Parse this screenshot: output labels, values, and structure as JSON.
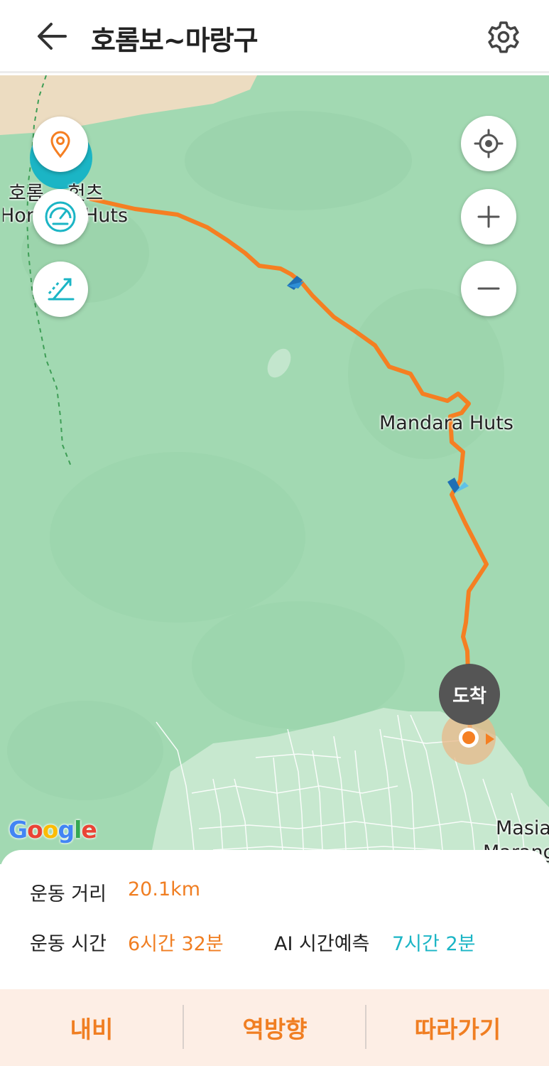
{
  "header": {
    "title": "호롬보~마랑구",
    "back_icon": "arrow-left-icon",
    "settings_icon": "gear-icon"
  },
  "map": {
    "labels": {
      "horombo_ko": "호롬",
      "horombo_ko_2": "헛츠",
      "horombo_en_1": "Horo",
      "horombo_en_2": "Huts",
      "mandara": "Mandara Huts",
      "masia": "Masia",
      "marangu": "Marang"
    },
    "arrival_label": "도착",
    "attribution": "Google",
    "route_color": "#f57f22",
    "left_controls": [
      "location-pin-icon",
      "speedometer-icon",
      "elevation-slope-icon"
    ],
    "right_controls": [
      "my-location-icon",
      "zoom-in-icon",
      "zoom-out-icon"
    ]
  },
  "stats": {
    "distance_label": "운동 거리",
    "distance_value": "20.1km",
    "time_label": "운동 시간",
    "time_value": "6시간 32분",
    "ai_label": "AI 시간예측",
    "ai_value": "7시간 2분"
  },
  "actions": {
    "nav": "내비",
    "reverse": "역방향",
    "follow": "따라가기"
  },
  "colors": {
    "accent": "#f07e22",
    "teal": "#1bb5c5",
    "map_green": "#a2d9b2",
    "action_bg": "#fdeee5"
  }
}
